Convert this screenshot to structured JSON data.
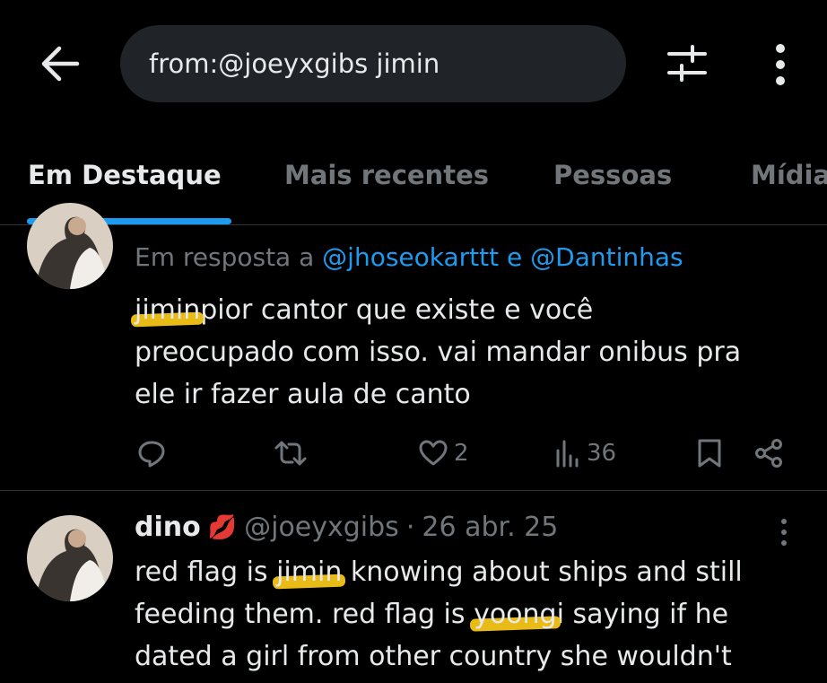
{
  "header": {
    "back_icon": "arrow-left-icon",
    "search_value": "from:@joeyxgibs jimin",
    "filters_icon": "sliders-icon",
    "more_icon": "more-vertical-icon"
  },
  "tabs": [
    {
      "label": "Em Destaque",
      "active": true
    },
    {
      "label": "Mais recentes",
      "active": false
    },
    {
      "label": "Pessoas",
      "active": false
    },
    {
      "label": "Mídia",
      "active": false
    }
  ],
  "tweet1": {
    "reply_prefix": "Em resposta a",
    "reply_user1": "@jhoseokarttt",
    "reply_join": "e",
    "reply_user2": "@Dantinhas",
    "hl_word": "jimin",
    "line1_rest": "pior cantor que existe e você",
    "line2": "preocupado com isso. vai mandar onibus pra",
    "line3": "ele ir fazer aula de canto",
    "likes": "2",
    "views": "36"
  },
  "tweet2": {
    "name": "dino",
    "emoji": "💋",
    "handle": "@joeyxgibs",
    "dot": "·",
    "date": "26 abr. 25",
    "l1_a": "red flag is",
    "l1_hl": "jimin",
    "l1_b": "knowing about ships and still",
    "l2_a": "feeding them. red flag is",
    "l2_hl": "yoong",
    "l2_b": "i saying if he",
    "l3": "dated a girl from other country she wouldn't"
  },
  "colors": {
    "accent": "#1d9bf0",
    "highlight": "#f5c518",
    "like_emoji": "#e0245e"
  }
}
